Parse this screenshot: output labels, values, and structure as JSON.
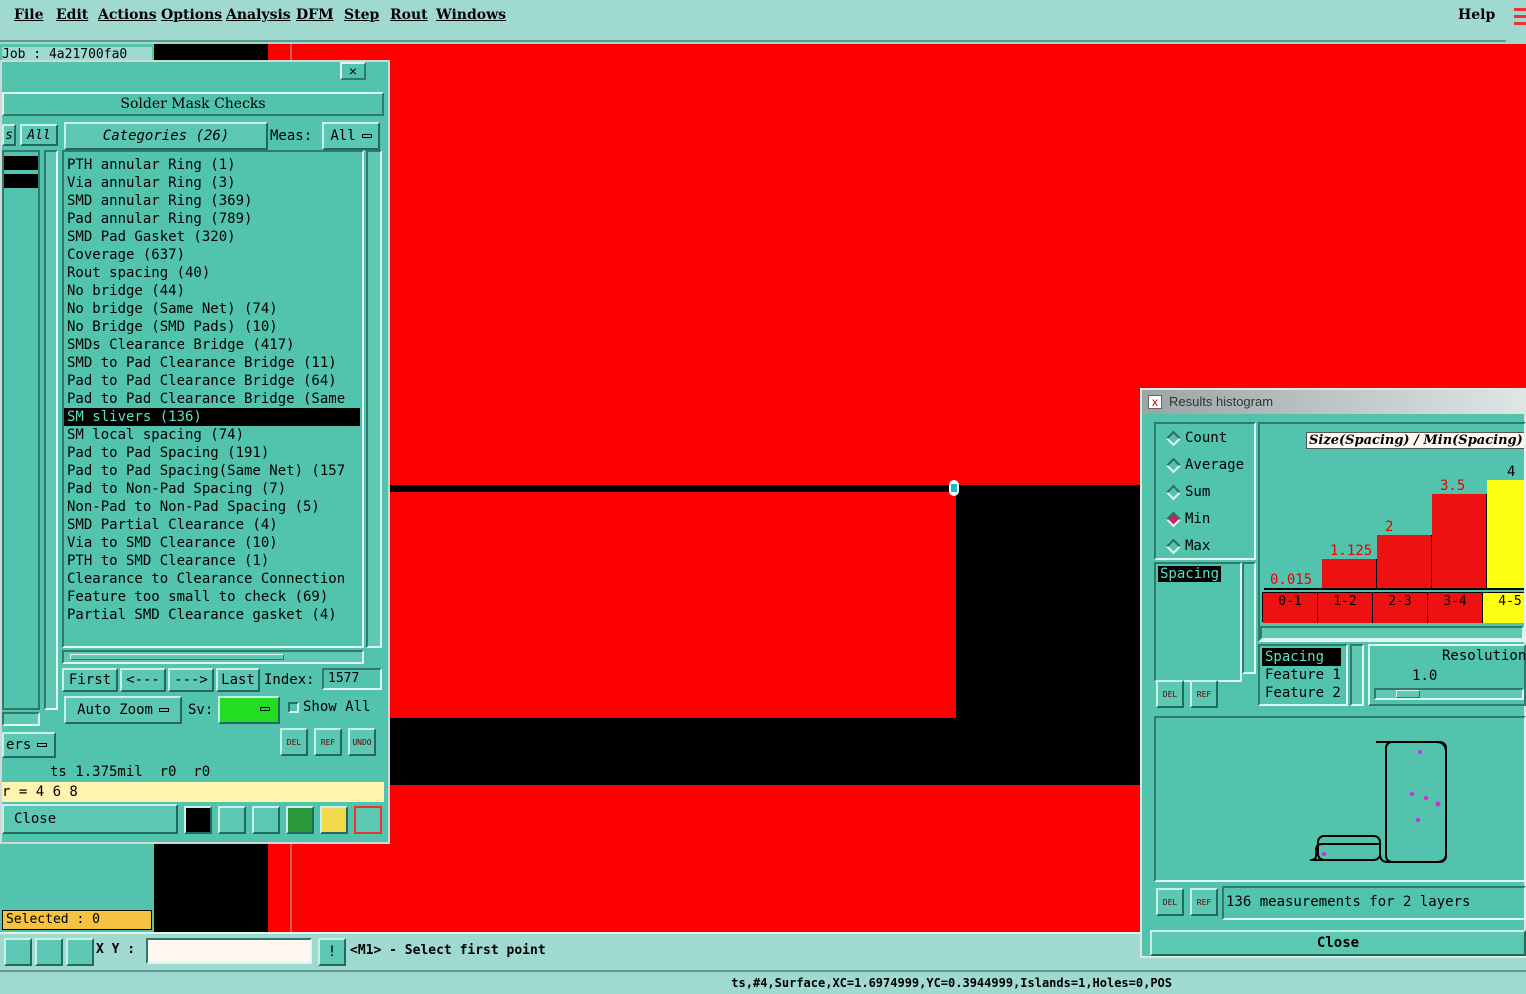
{
  "menubar": {
    "items": [
      "File",
      "Edit",
      "Actions",
      "Options",
      "Analysis",
      "DFM",
      "Step",
      "Rout",
      "Windows"
    ],
    "help": "Help"
  },
  "job_label": "Job : 4a21700fa0",
  "dialog": {
    "close_x": "×",
    "title": "Solder Mask Checks",
    "all_label": "All",
    "categories_label": "Categories (26)",
    "meas_label": "Meas:",
    "meas_value": "All",
    "categories": [
      "PTH annular Ring (1)",
      "Via annular Ring (3)",
      "SMD annular Ring (369)",
      "Pad annular Ring (789)",
      "SMD Pad Gasket (320)",
      "Coverage (637)",
      "Rout spacing (40)",
      "No bridge (44)",
      "No bridge (Same Net) (74)",
      "No Bridge (SMD Pads) (10)",
      "SMDs Clearance Bridge (417)",
      "SMD to Pad Clearance Bridge (11)",
      "Pad to Pad Clearance Bridge (64)",
      "Pad to Pad Clearance Bridge (Same",
      "SM slivers (136)",
      "SM local spacing (74)",
      "Pad to Pad Spacing (191)",
      "Pad to Pad Spacing(Same Net) (157",
      "Pad to Non-Pad Spacing (7)",
      "Non-Pad to Non-Pad Spacing (5)",
      "SMD Partial Clearance (4)",
      "Via to SMD Clearance (10)",
      "PTH to SMD Clearance (1)",
      "Clearance to Clearance Connection",
      "Feature too small to check (69)",
      "Partial SMD Clearance gasket (4)"
    ],
    "selected_index": 14,
    "nav": {
      "first": "First",
      "prev": "<---",
      "next": "--->",
      "last": "Last",
      "index_label": "Index:",
      "index_value": "1577"
    },
    "auto_zoom": "Auto Zoom",
    "sv_label": "Sv:",
    "show_all": "Show All",
    "layers_label": "ers",
    "status1": "ts 1.375mil  r0  r0",
    "status2": "r = 4 6 8",
    "close": "Close",
    "del": "DEL",
    "ref": "REF",
    "undo": "UNDO",
    "colors": {
      "bg": "#52c3ad",
      "green": "#22dd22"
    }
  },
  "selected_label": "Selected : 0",
  "bottom": {
    "xy_label": "X Y :",
    "prompt": "<M1> - Select first point",
    "status": "ts,#4,Surface,XC=1.6974999,YC=0.3944999,Islands=1,Holes=0,POS"
  },
  "histogram": {
    "title": "Results histogram",
    "radios": [
      {
        "label": "Count",
        "on": false
      },
      {
        "label": "Average",
        "on": false
      },
      {
        "label": "Sum",
        "on": false
      },
      {
        "label": "Min",
        "on": true
      },
      {
        "label": "Max",
        "on": false
      }
    ],
    "list_item": "Spacing",
    "chart_title": "Size(Spacing) / Min(Spacing)",
    "bins": [
      "0-1",
      "1-2",
      "2-3",
      "3-4",
      "4-5"
    ],
    "values": [
      0.015,
      1.125,
      2,
      3.5,
      4
    ],
    "value_labels": [
      "0.015",
      "1.125",
      "2",
      "3.5",
      "4"
    ],
    "bar_colors": [
      "#ee1111",
      "#ee1111",
      "#ee1111",
      "#ee1111",
      "#ffff11"
    ],
    "feature_list": [
      "Spacing",
      "Feature 1",
      "Feature 2"
    ],
    "resolution_label": "Resolution",
    "resolution_value": "1.0",
    "summary": "136 measurements for 2 layers",
    "close": "Close",
    "del": "DEL",
    "ref": "REF"
  }
}
